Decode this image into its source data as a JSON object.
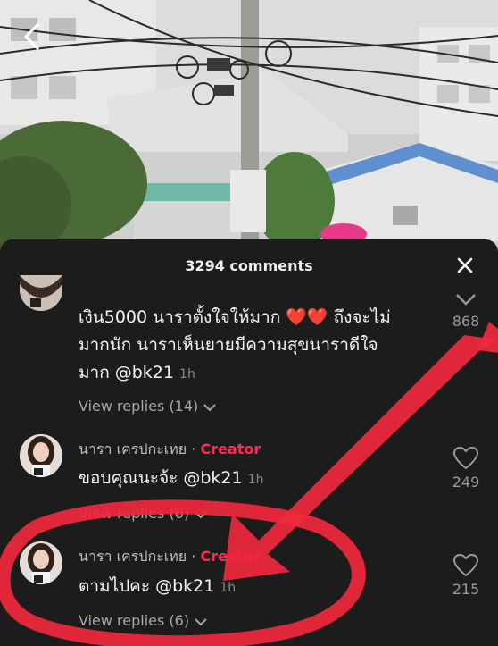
{
  "header": {
    "comment_count": "3294 comments"
  },
  "comments": [
    {
      "text_line1": "เงิน5000 นาราตั้งใจให้มาก ❤️❤️ ถึงจะไม่",
      "text_line2": "มากนัก นาราเห็นยายมีความสุขนาราดีใจ",
      "text_line3_prefix": "มาก @bk21",
      "time": "1h",
      "view_replies": "View replies (14)",
      "likes": "868"
    },
    {
      "username": "นารา เครปกะเทย",
      "separator": " · ",
      "badge": "Creator",
      "text": "ขอบคุณนะจ้ะ @bk21",
      "time": "1h",
      "view_replies": "View replies (6)",
      "likes": "249"
    },
    {
      "username": "นารา เครปกะเทย",
      "separator": " · ",
      "badge": "Creator",
      "text": "ตามไปคะ @bk21",
      "time": "1h",
      "view_replies": "View replies (6)",
      "likes": "215"
    }
  ],
  "colors": {
    "accent": "#fe2c55",
    "annotation": "#f0283c",
    "sheet": "#1c1c1c"
  },
  "icons": {
    "back": "chevron-left-icon",
    "close": "close-icon",
    "like": "heart-outline-icon",
    "collapse": "chevron-down-icon"
  }
}
